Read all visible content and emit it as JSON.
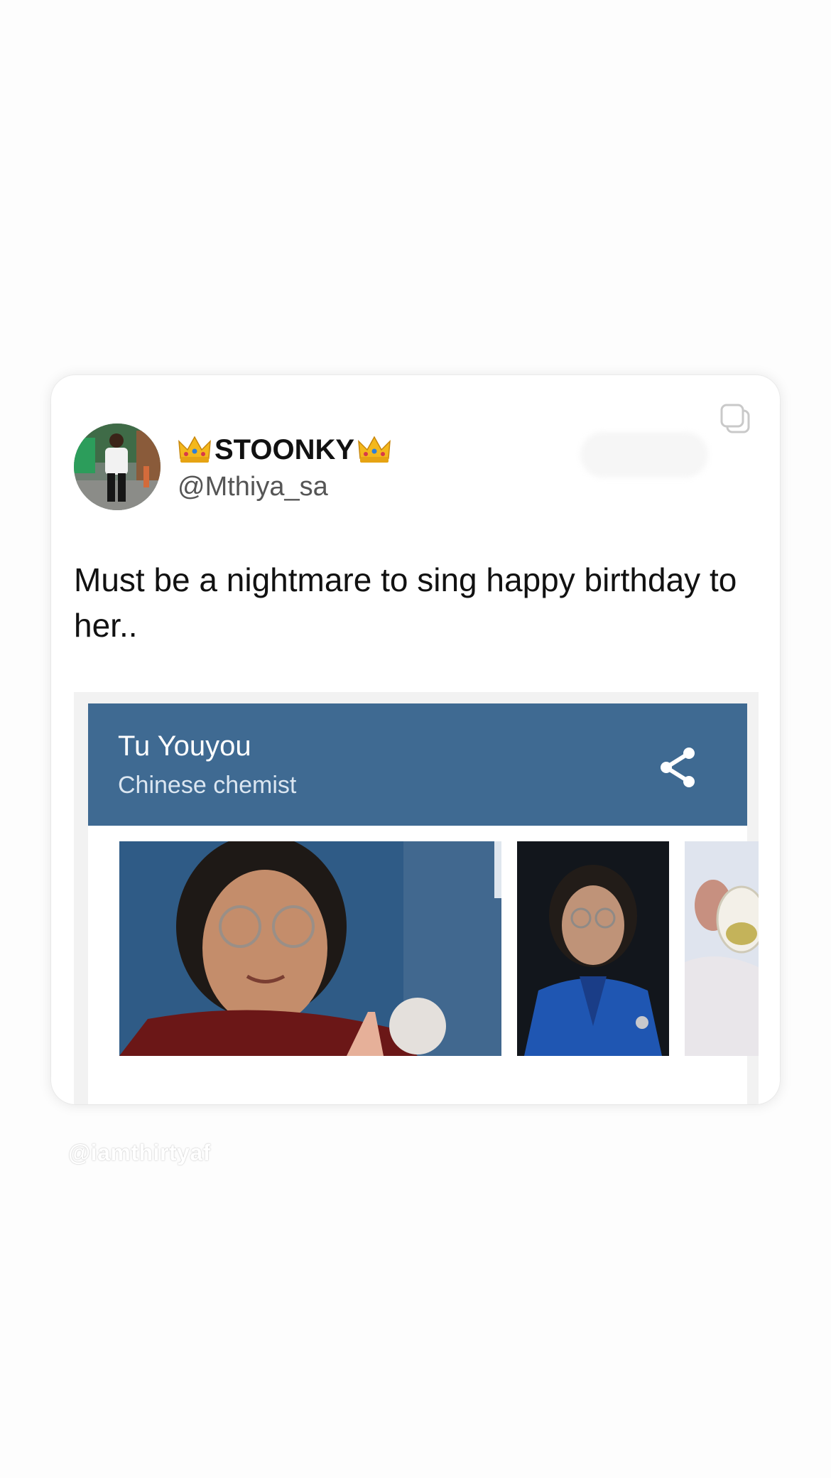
{
  "tweet": {
    "display_name": "STOONKY",
    "name_emoji": "crown-emoji",
    "handle": "@Mthiya_sa",
    "text": "Must be a nightmare to sing happy birthday to her..",
    "icons": {
      "copy": "copy-icon",
      "avatar": "avatar-photo"
    }
  },
  "knowledge_panel": {
    "title": "Tu Youyou",
    "subtitle": "Chinese chemist",
    "header_color": "#3f6a92",
    "icons": {
      "share": "share-icon"
    },
    "photos": [
      "photo-portrait-smiling",
      "photo-portrait-blue-jacket",
      "photo-lab-flask"
    ]
  },
  "watermark": "@iamthirtyaf"
}
